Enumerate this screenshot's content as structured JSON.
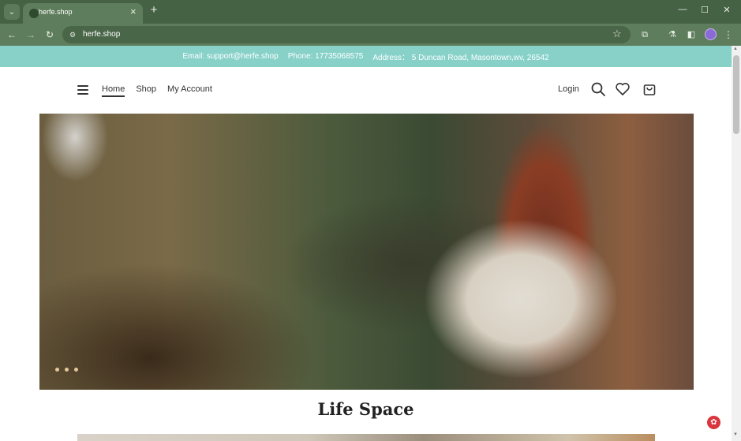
{
  "browser": {
    "tab_title": "herfe.shop",
    "url": "herfe.shop"
  },
  "topbar": {
    "email": "Email: support@herfe.shop",
    "phone": "Phone: 17735068575",
    "address": "Address： 5 Duncan Road, Masontown,wv, 26542"
  },
  "header": {
    "nav": [
      "Home",
      "Shop",
      "My Account"
    ],
    "active_nav": "Home",
    "login": "Login"
  },
  "hero": {
    "slide_count": 3
  },
  "section": {
    "title": "Life Space"
  },
  "colors": {
    "topbar": "#87d1c9",
    "browser_frame": "#466245",
    "chat_button": "#d9363e"
  },
  "icons": [
    "menu-icon",
    "search-icon",
    "heart-icon",
    "shopping-bag-icon",
    "chat-icon"
  ]
}
